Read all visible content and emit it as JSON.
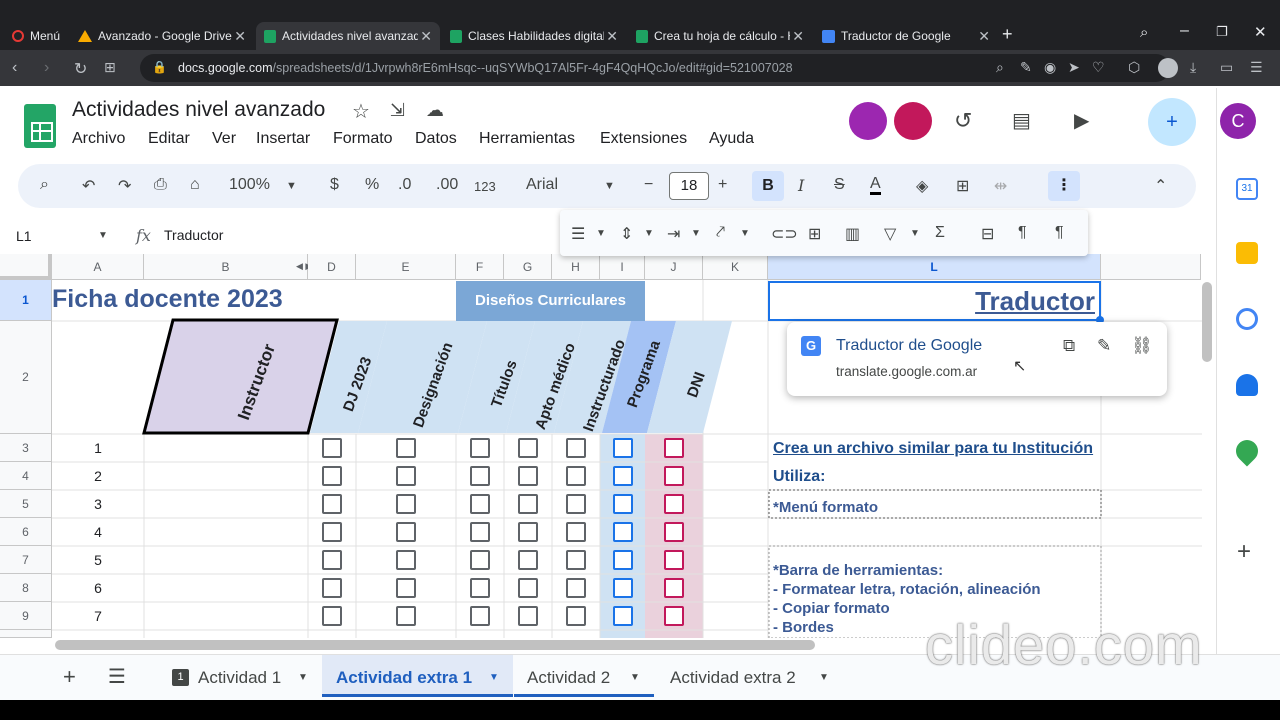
{
  "browser": {
    "tabs": [
      {
        "label": "Menú"
      },
      {
        "label": "Avanzado - Google Drive"
      },
      {
        "label": "Actividades nivel avanzado"
      },
      {
        "label": "Clases Habilidades digitales"
      },
      {
        "label": "Crea tu hoja de cálculo - H"
      },
      {
        "label": "Traductor de Google"
      }
    ],
    "url_host": "docs.google.com",
    "url_path": "/spreadsheets/d/1Jvrpwh8rE6mHsqc--uqSYWbQ17Al5Fr-4gF4QqHQcJo/edit#gid=521007028"
  },
  "doc": {
    "title": "Actividades nivel avanzado",
    "avatar_letter": "C"
  },
  "menus": [
    "Archivo",
    "Editar",
    "Ver",
    "Insertar",
    "Formato",
    "Datos",
    "Herramientas",
    "Extensiones",
    "Ayuda"
  ],
  "toolbar": {
    "zoom": "100%",
    "currency": "$",
    "percent": "%",
    "dec_less": ".0",
    "dec_more": ".00",
    "format_123": "123",
    "font": "Arial",
    "font_size": "18",
    "bold": "B",
    "italic": "I",
    "strike": "S",
    "text_color": "A"
  },
  "formula_bar": {
    "cell_ref": "L1",
    "fx": "fx",
    "value": "Traductor"
  },
  "grid": {
    "columns": [
      "A",
      "B",
      "D",
      "E",
      "F",
      "G",
      "H",
      "I",
      "J",
      "K",
      "L"
    ],
    "rows": [
      "1",
      "2",
      "3",
      "4",
      "5",
      "6",
      "7",
      "8",
      "9"
    ],
    "title": "Ficha docente 2023",
    "disenos": "Diseños Curriculares",
    "traductor": "Traductor",
    "headers": [
      "Instructor",
      "DJ 2023",
      "Designación",
      "Títulos",
      "Apto médico",
      "Instructurado",
      "Programa",
      "DNI"
    ],
    "numbers": [
      "1",
      "2",
      "3",
      "4",
      "5",
      "6",
      "7"
    ],
    "notes": {
      "crea": "Crea un archivo similar para tu Institución",
      "utiliza": "Utiliza:",
      "menu": "*Menú formato",
      "barra": "*Barra de herramientas:",
      "item1": "- Formatear letra, rotación, alineación",
      "item2": "- Copiar formato",
      "item3": "- Bordes"
    }
  },
  "link_card": {
    "title": "Traductor de Google",
    "url": "translate.google.com.ar"
  },
  "sheets": [
    {
      "label": "Actividad 1"
    },
    {
      "label": "Actividad extra 1"
    },
    {
      "label": "Actividad 2"
    },
    {
      "label": "Actividad extra 2"
    }
  ],
  "watermark": "clideo.com",
  "colors": {
    "accent": "#1a73e8",
    "title_blue": "#3c5a94",
    "header_purple": "#d9d2e9",
    "header_blue": "#cfe2f3",
    "prog_blue": "#a4c2f4",
    "dni_pink": "#ead1dc"
  }
}
